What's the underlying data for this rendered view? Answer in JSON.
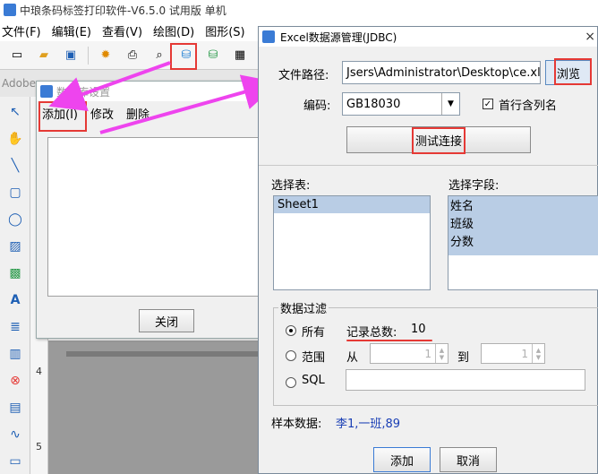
{
  "app": {
    "title": "中琅条码标签打印软件-V6.5.0 试用版 单机",
    "menu": [
      "文件(F)",
      "编辑(E)",
      "查看(V)",
      "绘图(D)",
      "图形(S)"
    ],
    "adobe_label": "Adobe",
    "ruler_marks": [
      "3",
      "4",
      "5"
    ]
  },
  "db_dialog": {
    "title": "数据库设置",
    "menu_add": "添加(I)",
    "menu_edit": "修改",
    "menu_delete": "删除",
    "close_label": "关闭"
  },
  "excel_dialog": {
    "title": "Excel数据源管理(JDBC)",
    "path_label": "文件路径:",
    "path_value": "Jsers\\Administrator\\Desktop\\ce.xls",
    "browse_label": "浏览",
    "encoding_label": "编码:",
    "encoding_value": "GB18030",
    "header_checkbox_label": "首行含列名",
    "test_conn_label": "测试连接",
    "table_label": "选择表:",
    "tables": [
      "Sheet1"
    ],
    "field_label": "选择字段:",
    "fields": [
      "姓名",
      "班级",
      "分数"
    ],
    "filter_label": "数据过滤",
    "radio_all": "所有",
    "record_total_label": "记录总数:",
    "record_total_value": "10",
    "radio_range": "范围",
    "from_label": "从",
    "from_value": "1",
    "to_label": "到",
    "to_value": "1",
    "radio_sql": "SQL",
    "sample_label": "样本数据:",
    "sample_value": "李1,一班,89",
    "add_label": "添加",
    "cancel_label": "取消",
    "close_glyph": "×"
  },
  "colors": {
    "highlight": "#e53935",
    "arrow": "#ee44ee",
    "selection": "#b9cde5",
    "sample_text": "#1a3fb5"
  }
}
